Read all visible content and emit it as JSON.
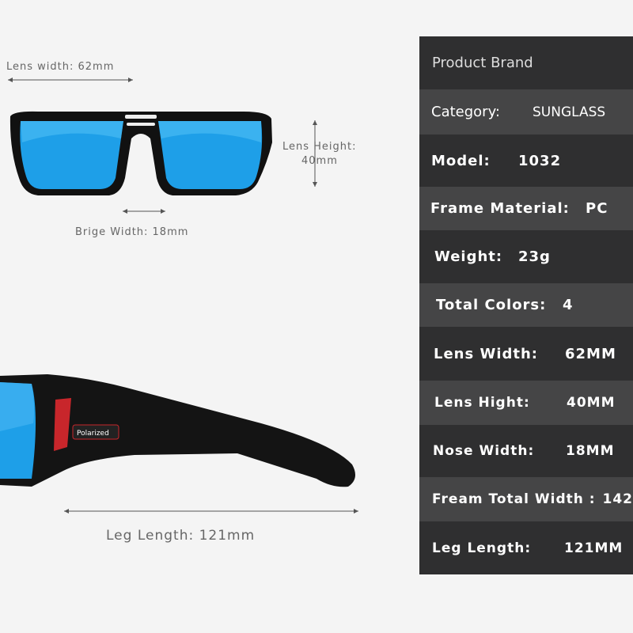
{
  "dimension_labels": {
    "lens_width": "Lens width:  62mm",
    "lens_height_label": "Lens Height:",
    "lens_height_value": "40mm",
    "bridge_width": "Brige Width: 18mm",
    "leg_length": "Leg Length:  121mm",
    "temple_badge": "Polarized"
  },
  "colors": {
    "lens": "#1e9fe8",
    "frame": "#111111",
    "accent": "#c8262b",
    "panel_dark": "#2f2f30",
    "panel_light": "#454546"
  },
  "specs": {
    "title": "Product Brand",
    "rows": [
      {
        "key": "Category:",
        "value": "SUNGLASS"
      },
      {
        "key": "Model:",
        "value": "1032"
      },
      {
        "key": "Frame Material:",
        "value": "PC"
      },
      {
        "key": "Weight:",
        "value": "23g"
      },
      {
        "key": "Total Colors:",
        "value": "4"
      },
      {
        "key": "Lens Width:",
        "value": "62MM"
      },
      {
        "key": "Lens Hight:",
        "value": "40MM"
      },
      {
        "key": "Nose Width:",
        "value": "18MM"
      },
      {
        "key": "Fream Total Width :",
        "value": "142"
      },
      {
        "key": "Leg Length:",
        "value": "121MM"
      }
    ]
  }
}
